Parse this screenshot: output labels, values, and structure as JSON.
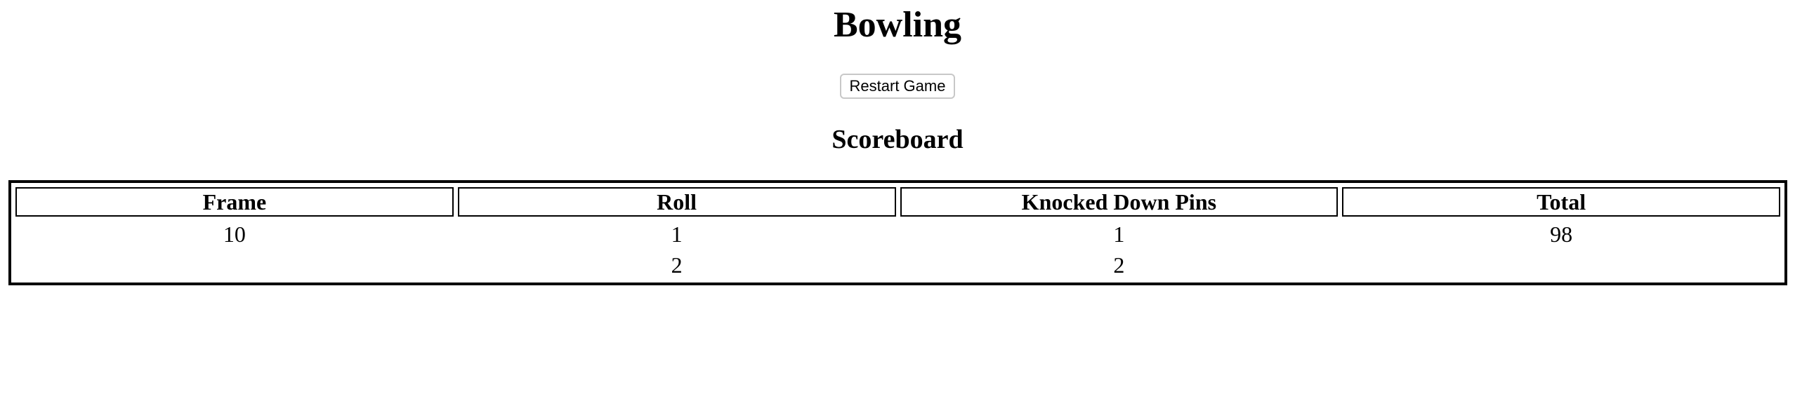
{
  "header": {
    "title": "Bowling"
  },
  "controls": {
    "restart_label": "Restart Game"
  },
  "scoreboard": {
    "heading": "Scoreboard",
    "columns": [
      "Frame",
      "Roll",
      "Knocked Down Pins",
      "Total"
    ],
    "rows": [
      [
        "10",
        "1",
        "1",
        "98"
      ],
      [
        "",
        "2",
        "2",
        ""
      ]
    ]
  }
}
